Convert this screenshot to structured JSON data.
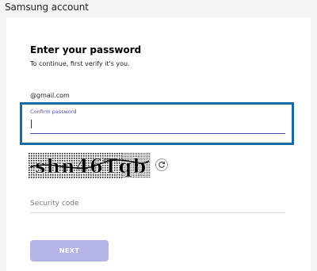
{
  "app": {
    "title": "Samsung account"
  },
  "form": {
    "heading": "Enter your password",
    "subtext": "To continue, first verify it's you.",
    "email": "@gmail.com",
    "password_label": "Confirm password",
    "password_value": "",
    "captcha_text": "shn46Tqb",
    "security_placeholder": "Security code",
    "security_value": "",
    "next_label": "NEXT"
  },
  "colors": {
    "focus_border": "#1a6aa3",
    "accent": "#4a4fb0",
    "button_disabled": "#b4b4e6"
  },
  "icons": {
    "refresh": "refresh-icon"
  }
}
